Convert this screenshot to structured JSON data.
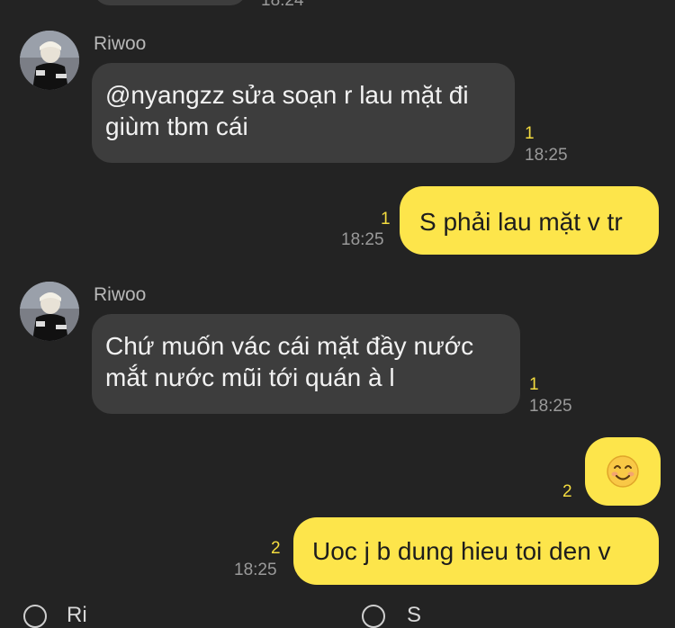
{
  "top_partial": {
    "time": "18:24"
  },
  "messages": [
    {
      "sender": "Riwoo",
      "text_line1": "@nyangzz sửa soạn r lau mặt đi",
      "text_line2": "giùm tbm cái",
      "unread": "1",
      "time": "18:25"
    },
    {
      "sender": "me",
      "text": "S phải lau mặt v tr",
      "unread": "1",
      "time": "18:25"
    },
    {
      "sender": "Riwoo",
      "text_line1": "Chứ muốn vác cái mặt đầy nước",
      "text_line2": "mắt nước mũi tới quán à l",
      "unread": "1",
      "time": "18:25"
    },
    {
      "sender": "me",
      "emoji": "😊",
      "unread": "2"
    },
    {
      "sender": "me",
      "text": "Uoc j b dung hieu toi den v",
      "unread": "2",
      "time": "18:25"
    }
  ],
  "bottom_partial": {
    "left": "Ri",
    "right": "S"
  }
}
